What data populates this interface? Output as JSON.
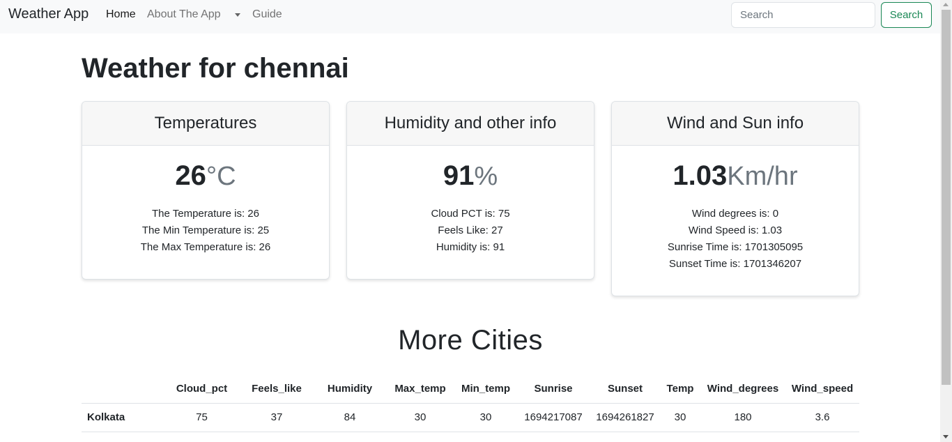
{
  "navbar": {
    "brand": "Weather App",
    "links": {
      "home": "Home",
      "about": "About The App",
      "guide": "Guide"
    },
    "search_placeholder": "Search",
    "search_button": "Search"
  },
  "page": {
    "title": "Weather for chennai"
  },
  "cards": {
    "temperature": {
      "header": "Temperatures",
      "value": "26",
      "unit": "°C",
      "lines": [
        "The Temperature is: 26",
        "The Min Temperature is: 25",
        "The Max Temperature is: 26"
      ]
    },
    "humidity": {
      "header": "Humidity and other info",
      "value": "91",
      "unit": "%",
      "lines": [
        "Cloud PCT is: 75",
        "Feels Like: 27",
        "Humidity is: 91"
      ]
    },
    "wind": {
      "header": "Wind and Sun info",
      "value": "1.03",
      "unit": "Km/hr",
      "lines": [
        "Wind degrees is: 0",
        "Wind Speed is: 1.03",
        "Sunrise Time is: 1701305095",
        "Sunset Time is: 1701346207"
      ]
    }
  },
  "more_cities": {
    "title": "More Cities",
    "columns": [
      "",
      "Cloud_pct",
      "Feels_like",
      "Humidity",
      "Max_temp",
      "Min_temp",
      "Sunrise",
      "Sunset",
      "Temp",
      "Wind_degrees",
      "Wind_speed"
    ],
    "rows": [
      {
        "city": "Kolkata",
        "values": [
          "75",
          "37",
          "84",
          "30",
          "30",
          "1694217087",
          "1694261827",
          "30",
          "180",
          "3.6"
        ]
      }
    ]
  }
}
